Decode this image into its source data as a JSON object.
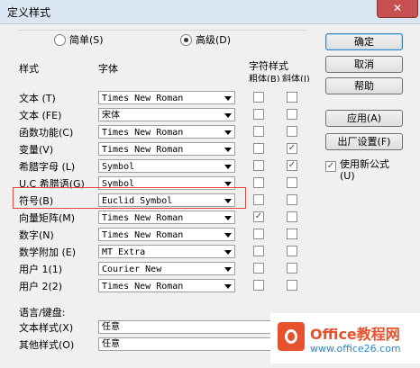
{
  "window": {
    "title": "定义样式",
    "close": "✕"
  },
  "mode": {
    "simple": "简单(S)",
    "advanced": "高级(D)",
    "selected": "advanced"
  },
  "headers": {
    "style": "样式",
    "font": "字体",
    "char_style": "字符样式",
    "bold": "粗体(B)",
    "italic": "斜体(I)"
  },
  "rows": [
    {
      "label": "文本 (T)",
      "font": "Times New Roman",
      "bold": false,
      "italic": false
    },
    {
      "label": "文本 (FE)",
      "font": "宋体",
      "bold": false,
      "italic": false
    },
    {
      "label": "函数功能(C)",
      "font": "Times New Roman",
      "bold": false,
      "italic": false
    },
    {
      "label": "变量(V)",
      "font": "Times New Roman",
      "bold": false,
      "italic": true
    },
    {
      "label": "希腊字母 (L)",
      "font": "Symbol",
      "bold": false,
      "italic": true
    },
    {
      "label": "U.C 希腊语(G)",
      "font": "Symbol",
      "bold": false,
      "italic": false
    },
    {
      "label": "符号(B)",
      "font": "Euclid Symbol",
      "bold": false,
      "italic": false
    },
    {
      "label": "向量矩阵(M)",
      "font": "Times New Roman",
      "bold": true,
      "italic": false
    },
    {
      "label": "数字(N)",
      "font": "Times New Roman",
      "bold": false,
      "italic": false
    },
    {
      "label": "数学附加 (E)",
      "font": "MT Extra",
      "bold": false,
      "italic": false
    },
    {
      "label": "用户 1(1)",
      "font": "Courier New",
      "bold": false,
      "italic": false
    },
    {
      "label": "用户 2(2)",
      "font": "Times New Roman",
      "bold": false,
      "italic": false
    }
  ],
  "buttons": {
    "ok": "确定",
    "cancel": "取消",
    "help": "帮助",
    "apply": "应用(A)",
    "factory": "出厂设置(F)"
  },
  "use_new_formula": {
    "label": "使用新公式(U)",
    "checked": true
  },
  "language": {
    "header": "语言/键盘:",
    "text_style_label": "文本样式(X)",
    "text_style_value": "任意",
    "other_style_label": "其他样式(O)",
    "other_style_value": "任意"
  },
  "watermark": {
    "brand": "Office教程网",
    "url": "www.office26.com"
  }
}
